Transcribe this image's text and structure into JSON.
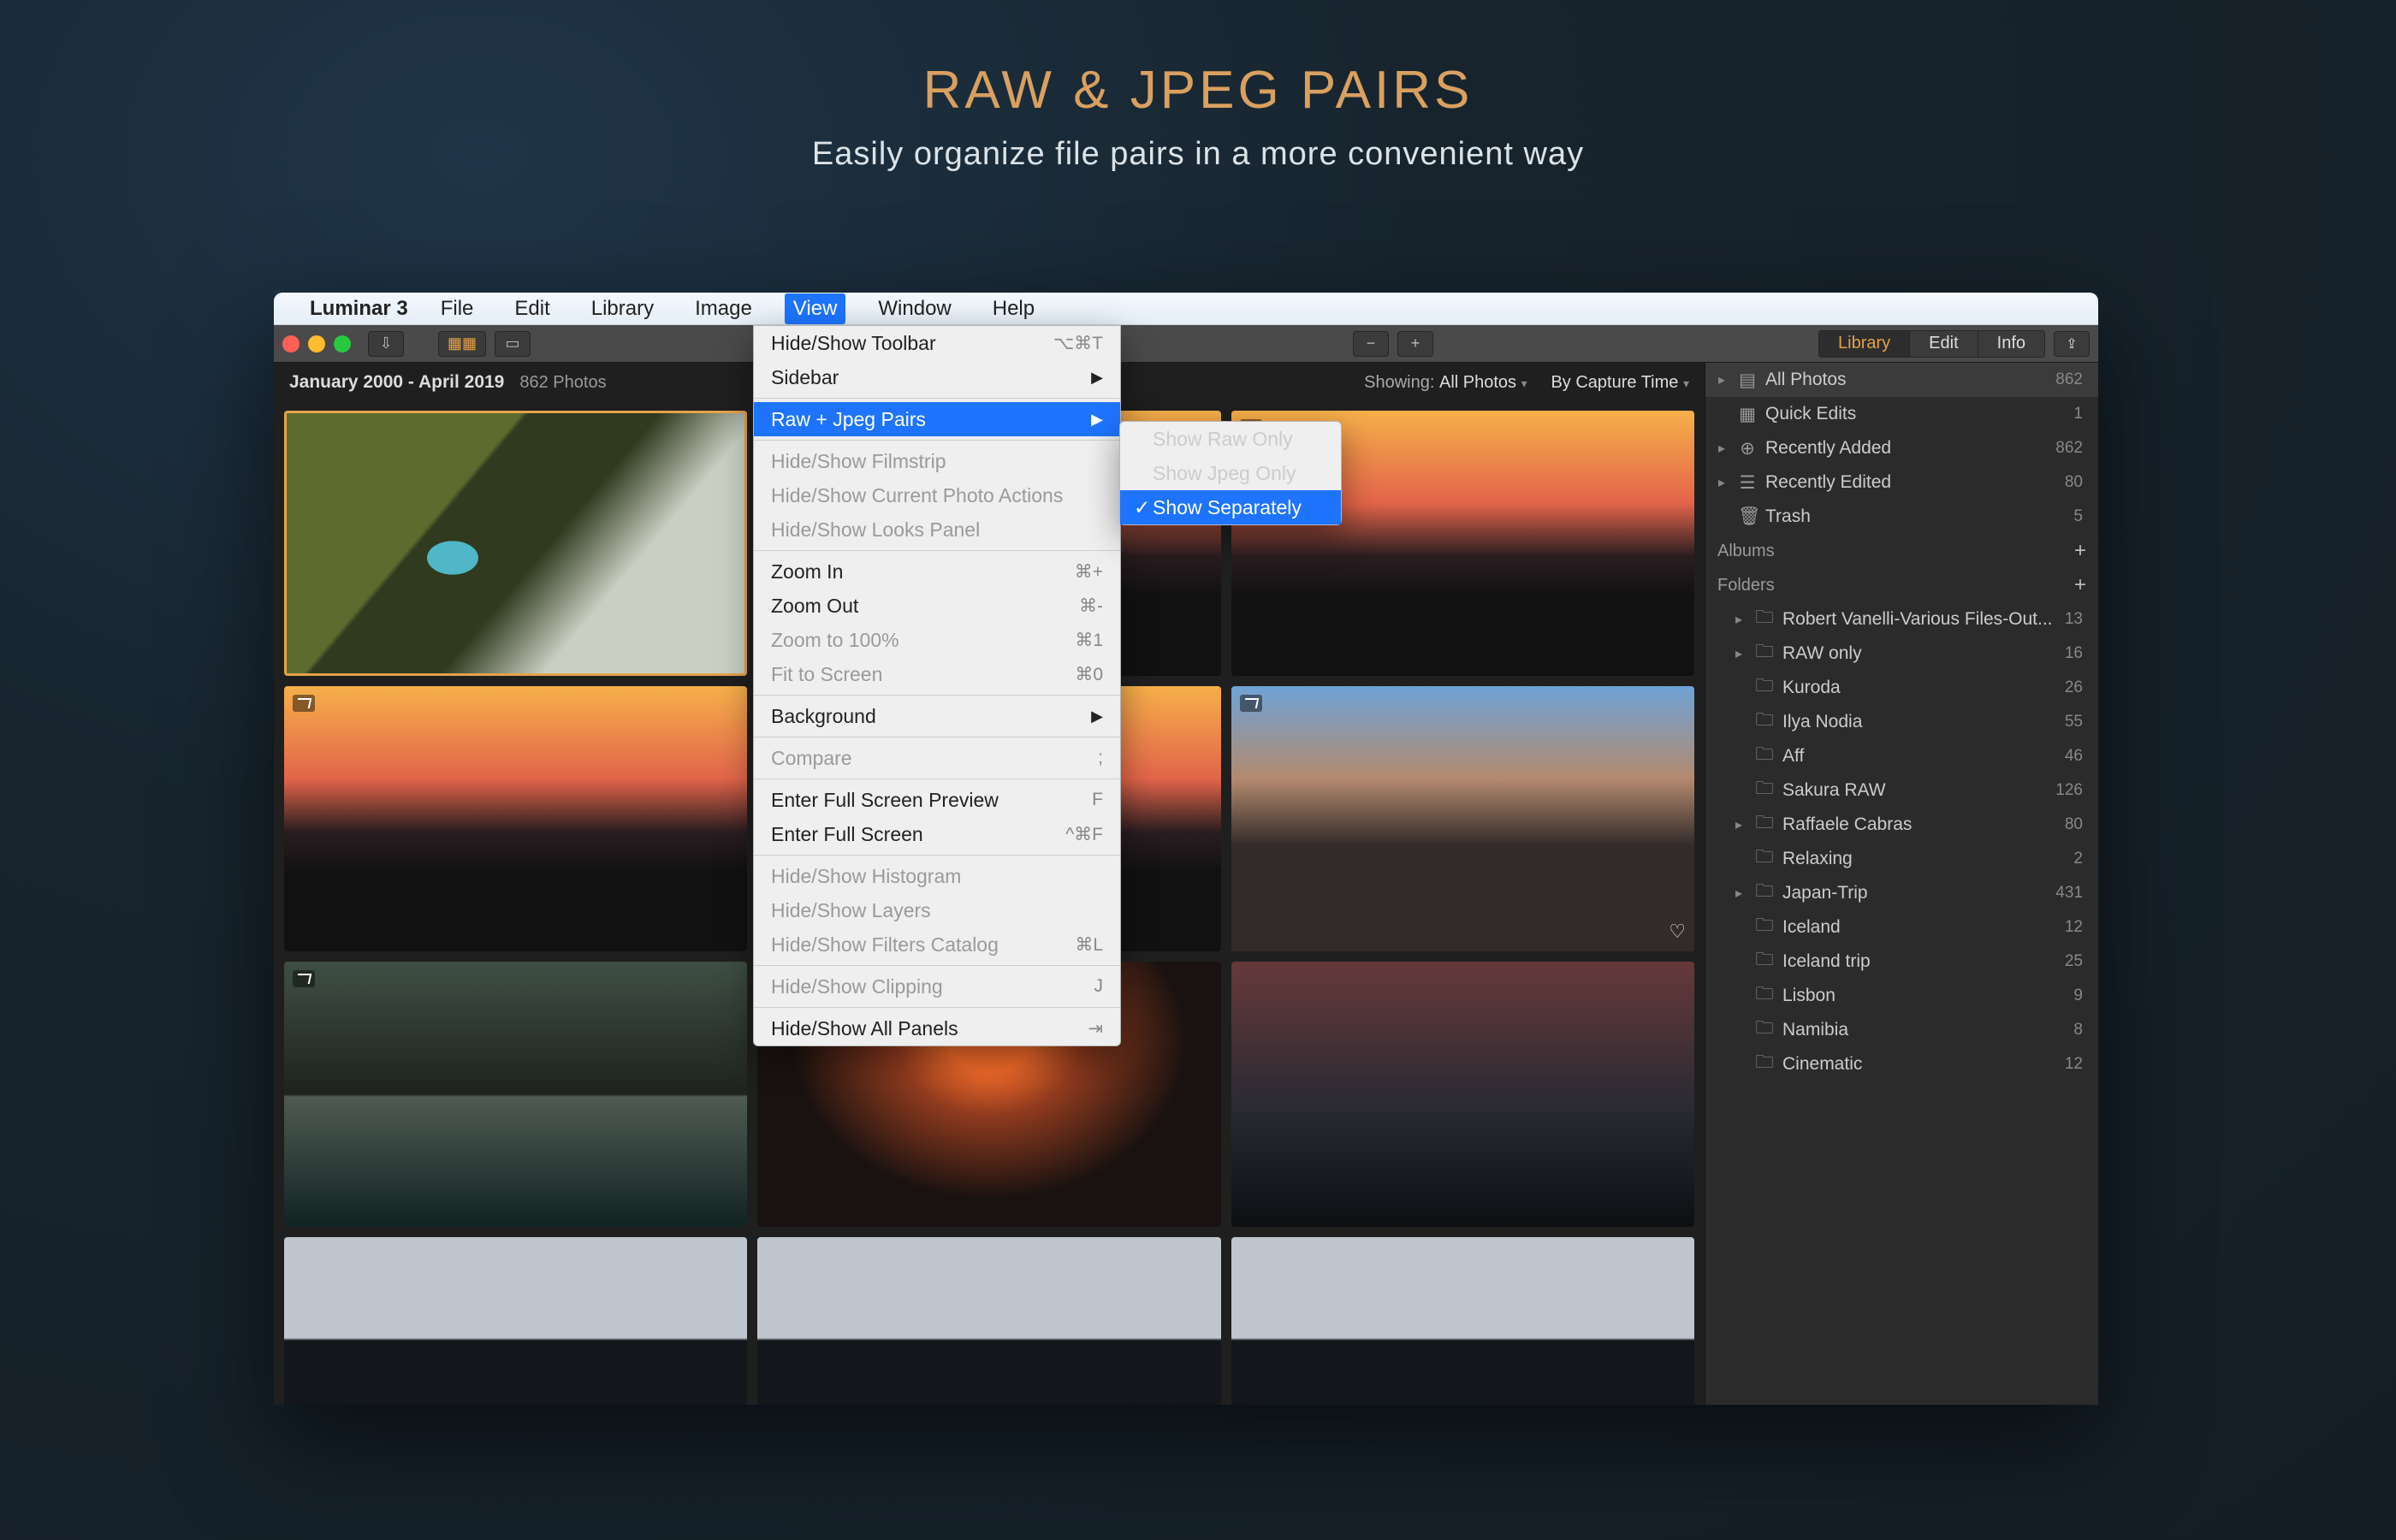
{
  "hero": {
    "title": "RAW & JPEG PAIRS",
    "subtitle": "Easily organize file pairs in a more convenient way"
  },
  "menubar": {
    "app": "Luminar 3",
    "items": [
      "File",
      "Edit",
      "Library",
      "Image",
      "View",
      "Window",
      "Help"
    ],
    "active": "View"
  },
  "toolbar": {
    "tabs": {
      "library": "Library",
      "edit": "Edit",
      "info": "Info"
    }
  },
  "grid": {
    "title": "All Photos",
    "range": "January 2000 - April 2019",
    "count": "862 Photos",
    "showing_label": "Showing:",
    "showing_value": "All Photos",
    "sort_label": "By Capture Time"
  },
  "view_menu": {
    "toolbar": "Hide/Show Toolbar",
    "toolbar_sc": "⌥⌘T",
    "sidebar": "Sidebar",
    "raw_jpeg": "Raw + Jpeg Pairs",
    "filmstrip": "Hide/Show Filmstrip",
    "cur_actions": "Hide/Show Current Photo Actions",
    "looks": "Hide/Show Looks Panel",
    "zoom_in": "Zoom In",
    "zoom_in_sc": "⌘+",
    "zoom_out": "Zoom Out",
    "zoom_out_sc": "⌘-",
    "zoom_100": "Zoom to 100%",
    "zoom_100_sc": "⌘1",
    "fit": "Fit to Screen",
    "fit_sc": "⌘0",
    "background": "Background",
    "compare": "Compare",
    "compare_sc": ";",
    "fs_preview": "Enter Full Screen Preview",
    "fs_preview_sc": "F",
    "fs": "Enter Full Screen",
    "fs_sc": "^⌘F",
    "hist": "Hide/Show Histogram",
    "layers": "Hide/Show Layers",
    "filters": "Hide/Show Filters Catalog",
    "filters_sc": "⌘L",
    "clipping": "Hide/Show Clipping",
    "clipping_sc": "J",
    "all_panels": "Hide/Show All Panels",
    "all_panels_sc": "⇥"
  },
  "raw_submenu": {
    "raw_only": "Show Raw Only",
    "jpeg_only": "Show Jpeg Only",
    "separately": "Show Separately"
  },
  "sidebar": {
    "shortcuts": [
      {
        "label": "All Photos",
        "count": "862",
        "icon": "▤",
        "active": true,
        "chev": "▸"
      },
      {
        "label": "Quick Edits",
        "count": "1",
        "icon": "▦"
      },
      {
        "label": "Recently Added",
        "count": "862",
        "icon": "⊕",
        "chev": "▸"
      },
      {
        "label": "Recently Edited",
        "count": "80",
        "icon": "☰",
        "chev": "▸"
      },
      {
        "label": "Trash",
        "count": "5",
        "icon": "🗑"
      }
    ],
    "albums_hdr": "Albums",
    "folders_hdr": "Folders",
    "folders": [
      {
        "label": "Robert Vanelli-Various Files-Out...",
        "count": "13",
        "chev": "▸"
      },
      {
        "label": "RAW only",
        "count": "16",
        "chev": "▸"
      },
      {
        "label": "Kuroda",
        "count": "26"
      },
      {
        "label": "Ilya Nodia",
        "count": "55"
      },
      {
        "label": "Aff",
        "count": "46"
      },
      {
        "label": "Sakura RAW",
        "count": "126"
      },
      {
        "label": "Raffaele Cabras",
        "count": "80",
        "chev": "▸"
      },
      {
        "label": "Relaxing",
        "count": "2"
      },
      {
        "label": "Japan-Trip",
        "count": "431",
        "chev": "▸"
      },
      {
        "label": "Iceland",
        "count": "12"
      },
      {
        "label": "Iceland trip",
        "count": "25"
      },
      {
        "label": "Lisbon",
        "count": "9"
      },
      {
        "label": "Namibia",
        "count": "8"
      },
      {
        "label": "Cinematic",
        "count": "12"
      }
    ]
  }
}
